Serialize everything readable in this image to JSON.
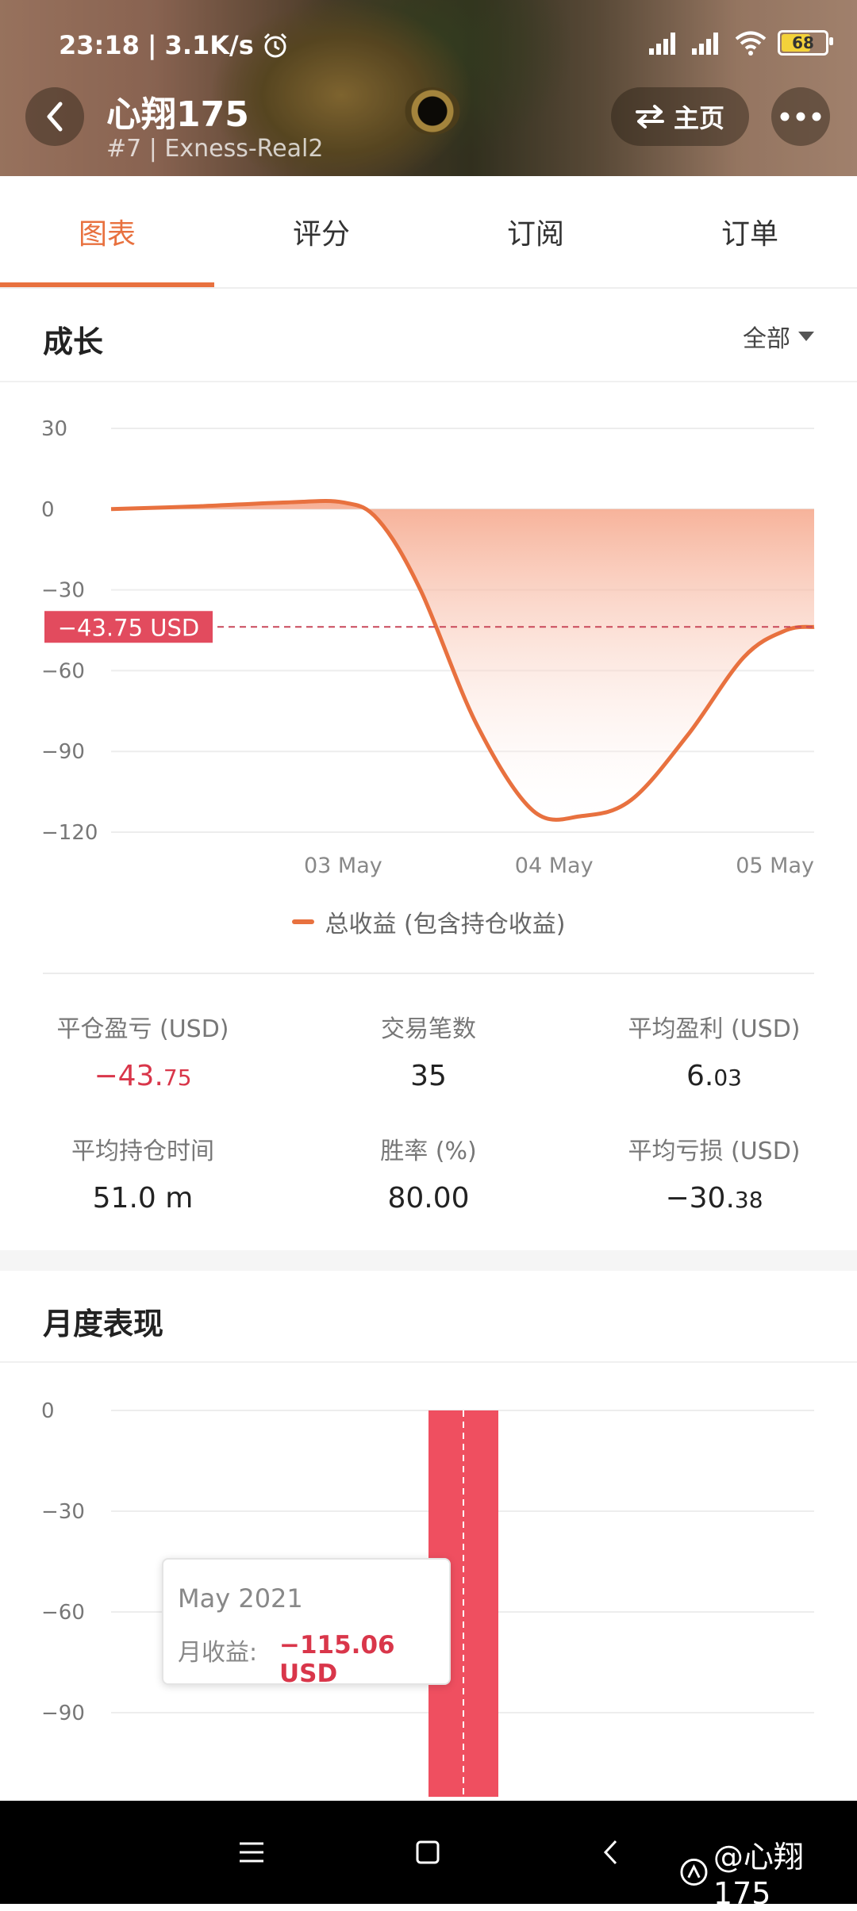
{
  "status_bar": {
    "time": "23:18",
    "speed": "3.1K/s",
    "battery": "68"
  },
  "header": {
    "name": "心翔175",
    "sub": "#7 | Exness-Real2",
    "home_label": "主页"
  },
  "tabs": [
    {
      "label": "图表",
      "active": true
    },
    {
      "label": "评分",
      "active": false
    },
    {
      "label": "订阅",
      "active": false
    },
    {
      "label": "订单",
      "active": false
    }
  ],
  "growth": {
    "title": "成长",
    "range_label": "全部"
  },
  "chart_data": [
    {
      "type": "area",
      "y_ticks": [
        "30",
        "0",
        "−30",
        "−60",
        "−90",
        "−120"
      ],
      "ylim": [
        -120,
        30
      ],
      "x_ticks": [
        "03 May",
        "04 May",
        "05 May"
      ],
      "series": [
        {
          "name": "总收益 (包含持仓收益)",
          "points": [
            {
              "x": 0.0,
              "y": 0
            },
            {
              "x": 0.12,
              "y": 1
            },
            {
              "x": 0.25,
              "y": 2.5
            },
            {
              "x": 0.33,
              "y": 2.5
            },
            {
              "x": 0.38,
              "y": -4
            },
            {
              "x": 0.44,
              "y": -30
            },
            {
              "x": 0.52,
              "y": -80
            },
            {
              "x": 0.6,
              "y": -112
            },
            {
              "x": 0.67,
              "y": -114
            },
            {
              "x": 0.74,
              "y": -108
            },
            {
              "x": 0.82,
              "y": -84
            },
            {
              "x": 0.9,
              "y": -55
            },
            {
              "x": 0.96,
              "y": -45
            },
            {
              "x": 1.0,
              "y": -43.75
            }
          ]
        }
      ],
      "current_value": -43.75,
      "current_label": "−43.75 USD",
      "legend": "总收益 (包含持仓收益)"
    },
    {
      "type": "bar",
      "y_ticks": [
        "0",
        "−30",
        "−60",
        "−90"
      ],
      "ylim": [
        -115.06,
        0
      ],
      "categories": [
        "May 2021"
      ],
      "values": [
        -115.06
      ],
      "tooltip": {
        "title": "May 2021",
        "label": "月收益:",
        "value": "−115.06 USD"
      }
    }
  ],
  "stats": [
    {
      "label": "平仓盈亏 (USD)",
      "main": "−43.",
      "minor": "75",
      "negative": true
    },
    {
      "label": "交易笔数",
      "main": "35",
      "minor": "",
      "negative": false
    },
    {
      "label": "平均盈利 (USD)",
      "main": "6.",
      "minor": "03",
      "negative": false
    },
    {
      "label": "平均持仓时间",
      "main": "51.0 m",
      "minor": "",
      "negative": false
    },
    {
      "label": "胜率 (%)",
      "main": "80.00",
      "minor": "",
      "negative": false
    },
    {
      "label": "平均亏损 (USD)",
      "main": "−30.",
      "minor": "38",
      "negative": false
    }
  ],
  "monthly": {
    "title": "月度表现"
  },
  "watermark": "@心翔175",
  "colors": {
    "accent": "#e8713f",
    "negative": "#d9364a",
    "bar": "#ef4f60"
  }
}
